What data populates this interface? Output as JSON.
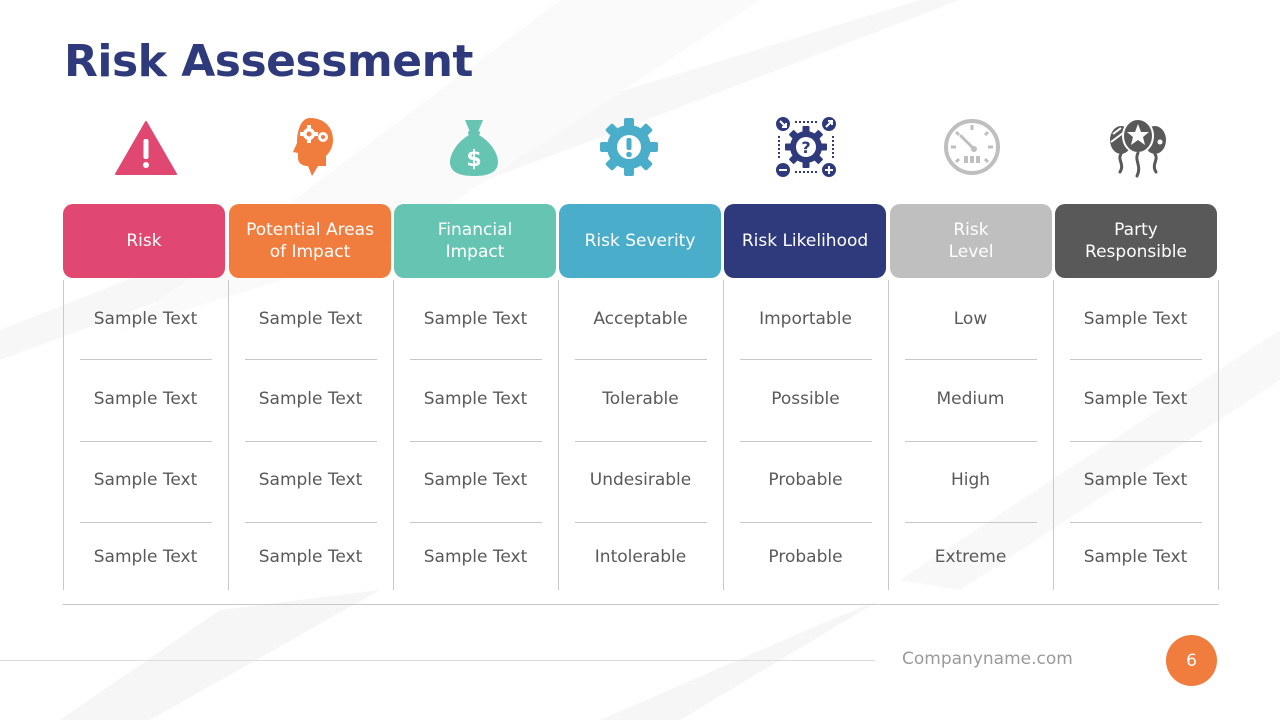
{
  "slide": {
    "title": "Risk Assessment",
    "footer_url": "Companyname.com",
    "page_number": "6"
  },
  "colors": {
    "title": "#2e3a7c",
    "risk": "#e04872",
    "impact_areas": "#f07c3e",
    "financial": "#66c5b2",
    "severity": "#4aaecb",
    "likelihood": "#2e3a7c",
    "level": "#bfbfbf",
    "party": "#595959",
    "page_badge": "#f07c3e"
  },
  "columns": [
    {
      "key": "risk",
      "header": "Risk",
      "icon": "warning-triangle-icon",
      "cells": [
        "Sample Text",
        "Sample Text",
        "Sample Text",
        "Sample Text"
      ]
    },
    {
      "key": "impact_areas",
      "header": "Potential Areas\nof Impact",
      "icon": "head-gears-icon",
      "cells": [
        "Sample Text",
        "Sample Text",
        "Sample Text",
        "Sample Text"
      ]
    },
    {
      "key": "financial",
      "header": "Financial\nImpact",
      "icon": "money-bag-icon",
      "cells": [
        "Sample Text",
        "Sample Text",
        "Sample Text",
        "Sample Text"
      ]
    },
    {
      "key": "severity",
      "header": "Risk Severity",
      "icon": "gear-alert-icon",
      "cells": [
        "Acceptable",
        "Tolerable",
        "Undesirable",
        "Intolerable"
      ]
    },
    {
      "key": "likelihood",
      "header": "Risk Likelihood",
      "icon": "gear-question-icon",
      "cells": [
        "Importable",
        "Possible",
        "Probable",
        "Probable"
      ]
    },
    {
      "key": "level",
      "header": "Risk\nLevel",
      "icon": "gauge-icon",
      "cells": [
        "Low",
        "Medium",
        "High",
        "Extreme"
      ]
    },
    {
      "key": "party",
      "header": "Party\nResponsible",
      "icon": "balloons-icon",
      "cells": [
        "Sample Text",
        "Sample Text",
        "Sample Text",
        "Sample Text"
      ]
    }
  ]
}
